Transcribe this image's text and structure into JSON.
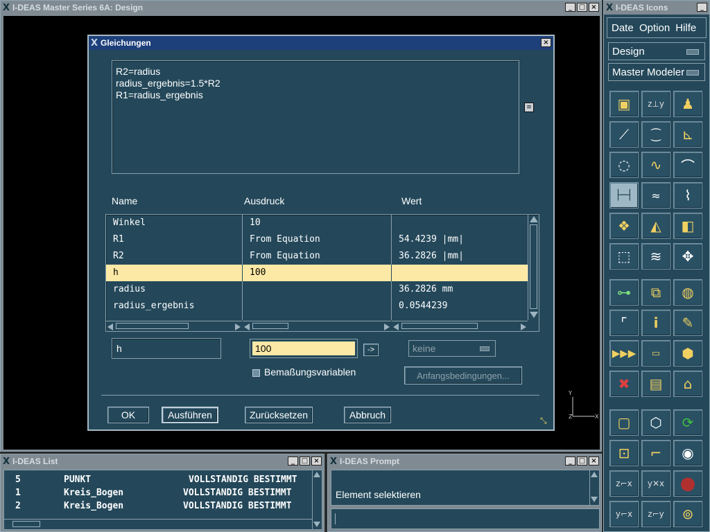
{
  "main_window": {
    "title": "I-DEAS Master Series 6A:    Design"
  },
  "icons_window": {
    "title": "I-DEAS Icons",
    "menu": [
      "Datei",
      "Option",
      "Hilfe"
    ],
    "application": "Design",
    "task": "Master Modeler"
  },
  "dialog": {
    "title": "Gleichungen",
    "equations": [
      "R2=radius",
      "radius_ergebnis=1.5*R2",
      "R1=radius_ergebnis"
    ],
    "columns": {
      "name": "Name",
      "expression": "Ausdruck",
      "value": "Wert"
    },
    "rows": [
      {
        "name": "Winkel",
        "expression": "10",
        "value": ""
      },
      {
        "name": "R1",
        "expression": "From Equation",
        "value": "54.4239 |mm|"
      },
      {
        "name": "R2",
        "expression": "From Equation",
        "value": "36.2826 |mm|"
      },
      {
        "name": "h",
        "expression": "100",
        "value": ""
      },
      {
        "name": "radius",
        "expression": "",
        "value": "36.2826 mm"
      },
      {
        "name": "radius_ergebnis",
        "expression": "",
        "value": "0.0544239"
      }
    ],
    "selected_row": 3,
    "name_field": "h",
    "expression_field": "100",
    "apply_arrow": "->",
    "unit_select": "keine",
    "checkbox_label": "Bemaßungsvariablen",
    "initial_conditions_button": "Anfangsbedingungen...",
    "buttons": {
      "ok": "OK",
      "execute": "Ausführen",
      "reset": "Zurücksetzen",
      "cancel": "Abbruch"
    }
  },
  "list_window": {
    "title": "I-DEAS List",
    "rows": [
      {
        "num": "5",
        "type": "PUNKT",
        "status": "VOLLSTÄNDIG BESTIMMT"
      },
      {
        "num": "1",
        "type": "Kreis_Bogen",
        "status": "VOLLSTÄNDIG BESTIMMT"
      },
      {
        "num": "2",
        "type": "Kreis_Bogen",
        "status": "VOLLSTÄNDIG BESTIMMT"
      }
    ]
  },
  "prompt_window": {
    "title": "I-DEAS Prompt",
    "message": "Element selektieren",
    "input": ""
  },
  "triad": {
    "y": "Y",
    "z": "Z",
    "x": "X"
  },
  "colors": {
    "selection": "#fde9a6",
    "panel": "#24485a",
    "accent": "#f0d060"
  }
}
